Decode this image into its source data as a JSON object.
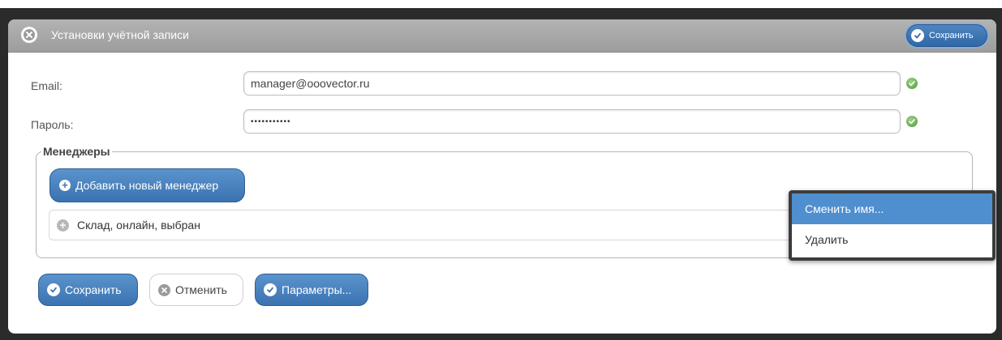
{
  "titlebar": {
    "title": "Установки учётной записи",
    "save_label": "Сохранить"
  },
  "form": {
    "email_label": "Email:",
    "email_value": "manager@ooovector.ru",
    "password_label": "Пароль:",
    "password_value": "•••••••••••"
  },
  "managers": {
    "legend": "Менеджеры",
    "add_label": "Добавить новый менеджер",
    "items": [
      {
        "label": "Склад, онлайн, выбран"
      }
    ]
  },
  "context_menu": {
    "items": [
      {
        "label": "Сменить имя..."
      },
      {
        "label": "Удалить"
      }
    ]
  },
  "footer": {
    "save_label": "Сохранить",
    "cancel_label": "Отменить",
    "params_label": "Параметры..."
  },
  "colors": {
    "accent": "#3a73b1",
    "menu_highlight": "#4f8fcf",
    "ok_green": "#4f9a3a",
    "titlebar": "#a8a8a8"
  },
  "icons": {
    "title_close": "close-circle-icon",
    "valid": "check-circle-icon",
    "add": "plus-icon",
    "cancel": "x-circle-icon"
  }
}
